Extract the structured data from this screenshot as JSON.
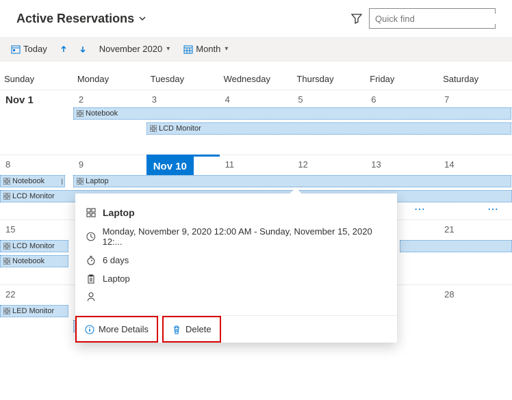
{
  "header": {
    "title": "Active Reservations"
  },
  "search": {
    "placeholder": "Quick find"
  },
  "toolbar": {
    "today": "Today",
    "month_label": "November 2020",
    "view_label": "Month"
  },
  "dayheaders": [
    "Sunday",
    "Monday",
    "Tuesday",
    "Wednesday",
    "Thursday",
    "Friday",
    "Saturday"
  ],
  "weeks": {
    "w1": [
      "Nov 1",
      "2",
      "3",
      "4",
      "5",
      "6",
      "7"
    ],
    "w2": [
      "8",
      "9",
      "Nov 10",
      "11",
      "12",
      "13",
      "14"
    ],
    "w3": [
      "15",
      "",
      "",
      "",
      "",
      "",
      "21"
    ],
    "w4": [
      "22",
      "",
      "",
      "",
      "",
      "",
      "28"
    ]
  },
  "events": {
    "notebook": "Notebook",
    "lcd": "LCD Monitor",
    "laptop": "Laptop",
    "led": "LED Monitor"
  },
  "popup": {
    "title": "Laptop",
    "when": "Monday, November 9, 2020 12:00 AM - Sunday, November 15, 2020 12:...",
    "duration": "6 days",
    "resource": "Laptop",
    "more": "More Details",
    "delete": "Delete"
  }
}
